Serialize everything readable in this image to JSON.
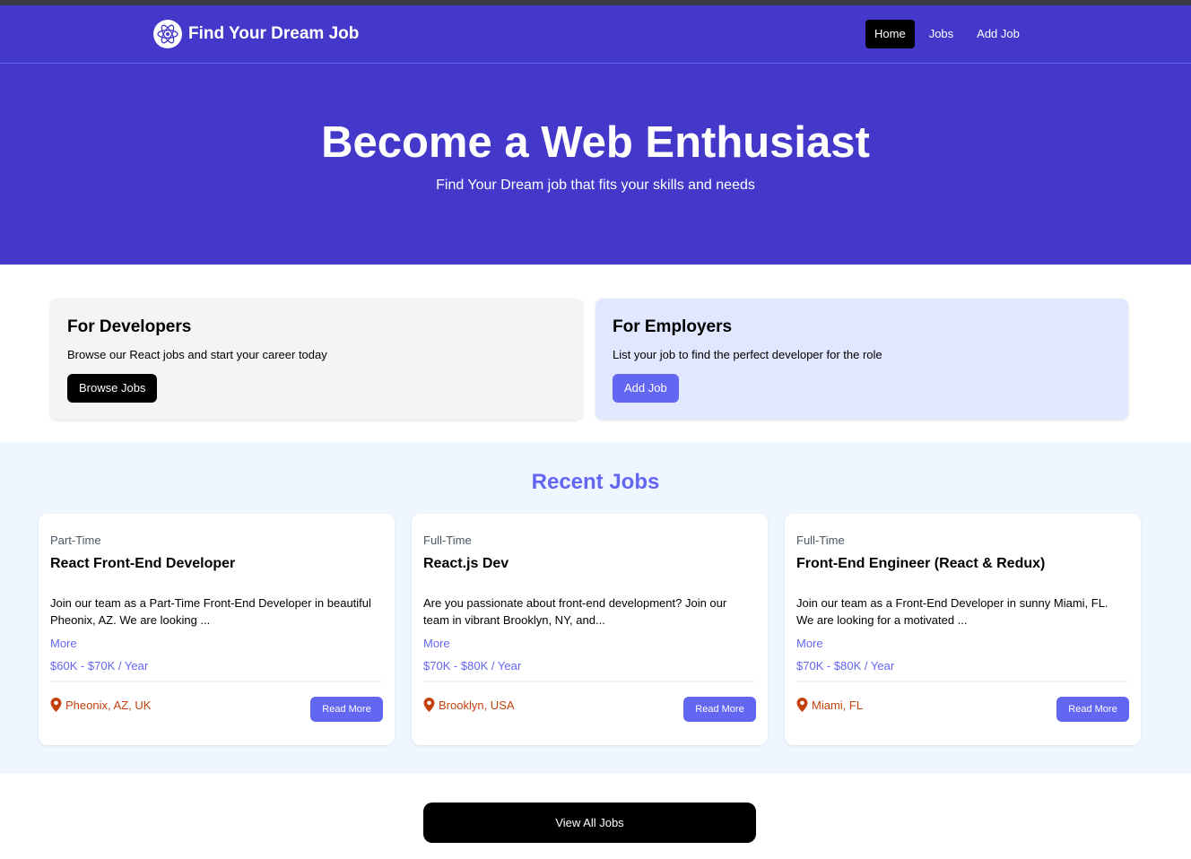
{
  "navbar": {
    "brand": "Find Your Dream Job",
    "links": [
      {
        "label": "Home",
        "active": true
      },
      {
        "label": "Jobs",
        "active": false
      },
      {
        "label": "Add Job",
        "active": false
      }
    ]
  },
  "hero": {
    "title": "Become a Web Enthusiast",
    "subtitle": "Find Your Dream job that fits your skills and needs"
  },
  "cards": {
    "developers": {
      "title": "For Developers",
      "text": "Browse our React jobs and start your career today",
      "button": "Browse Jobs"
    },
    "employers": {
      "title": "For Employers",
      "text": "List your job to find the perfect developer for the role",
      "button": "Add Job"
    }
  },
  "recent": {
    "title": "Recent Jobs",
    "jobs": [
      {
        "type": "Part-Time",
        "title": "React Front-End Developer",
        "description": "Join our team as a Part-Time Front-End Developer in beautiful Pheonix, AZ. We are looking ...",
        "more": "More",
        "salary": "$60K - $70K / Year",
        "location": "Pheonix, AZ, UK",
        "button": "Read More"
      },
      {
        "type": "Full-Time",
        "title": "React.js Dev",
        "description": "Are you passionate about front-end development? Join our team in vibrant Brooklyn, NY, and...",
        "more": "More",
        "salary": "$70K - $80K / Year",
        "location": "Brooklyn, USA",
        "button": "Read More"
      },
      {
        "type": "Full-Time",
        "title": "Front-End Engineer (React & Redux)",
        "description": "Join our team as a Front-End Developer in sunny Miami, FL. We are looking for a motivated ...",
        "more": "More",
        "salary": "$70K - $80K / Year",
        "location": "Miami, FL",
        "button": "Read More"
      }
    ]
  },
  "view_all": "View All Jobs",
  "colors": {
    "brand": "#4338ca",
    "accent": "#6366f1",
    "location": "#c2410c"
  },
  "icons": {
    "logo": "react-atom-icon",
    "location": "map-marker-icon"
  }
}
